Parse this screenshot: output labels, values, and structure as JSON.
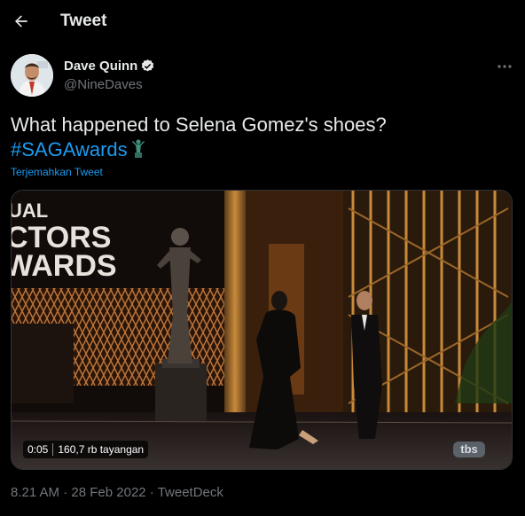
{
  "header": {
    "title": "Tweet"
  },
  "author": {
    "name": "Dave Quinn",
    "handle": "@NineDaves",
    "verified": true
  },
  "tweet": {
    "text": "What happened to Selena Gomez's shoes?",
    "hashtag": "#SAGAwards",
    "translate_label": "Terjemahkan Tweet"
  },
  "media": {
    "duration": "0:05",
    "views": "160,7 rb tayangan",
    "sign_lines": [
      "UAL",
      "CTORS",
      "WARDS"
    ],
    "watermark": "tbs"
  },
  "footer": {
    "time": "8.21 AM",
    "sep1": " · ",
    "date": "28 Feb 2022",
    "sep2": " · ",
    "source": "TweetDeck"
  },
  "colors": {
    "background": "#000000",
    "accent": "#1d9bf0",
    "muted": "#71767b",
    "text": "#e7e9ea"
  },
  "icons": {
    "back": "arrow-left-icon",
    "verified": "verified-badge-icon",
    "more": "more-dots-icon",
    "emoji": "trophy-statue-emoji"
  }
}
